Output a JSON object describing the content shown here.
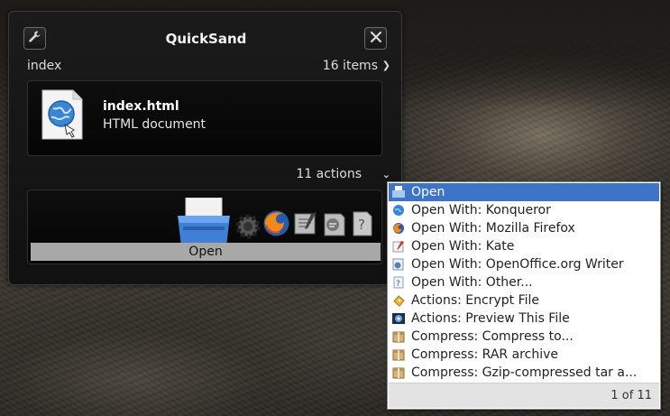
{
  "window": {
    "title": "QuickSand",
    "query": "index",
    "items_count": "16 items",
    "actions_count": "11 actions"
  },
  "icons": {
    "settings": "wrench-icon",
    "close": "close-icon",
    "items_chevron": "chevron-right-icon",
    "actions_chevron": "chevron-down-icon"
  },
  "selected_item": {
    "name": "index.html",
    "type": "HTML document",
    "icon": "html-file-icon"
  },
  "action_strip": {
    "current_label": "Open",
    "icons": [
      "open-printer-icon",
      "gear-icon",
      "firefox-icon",
      "kate-icon",
      "openoffice-writer-icon",
      "help-icon"
    ]
  },
  "action_list": {
    "items": [
      {
        "label": "Open",
        "icon": "printer-icon",
        "selected": true
      },
      {
        "label": "Open With: Konqueror",
        "icon": "konqueror-icon"
      },
      {
        "label": "Open With: Mozilla Firefox",
        "icon": "firefox-icon"
      },
      {
        "label": "Open With: Kate",
        "icon": "kate-icon"
      },
      {
        "label": "Open With: OpenOffice.org Writer",
        "icon": "writer-icon"
      },
      {
        "label": "Open With: Other...",
        "icon": "help-icon"
      },
      {
        "label": "Actions: Encrypt File",
        "icon": "lock-icon"
      },
      {
        "label": "Actions: Preview This File",
        "icon": "preview-icon"
      },
      {
        "label": "Compress: Compress to...",
        "icon": "archive-icon"
      },
      {
        "label": "Compress: RAR archive",
        "icon": "archive-icon"
      },
      {
        "label": "Compress: Gzip-compressed tar a...",
        "icon": "archive-icon"
      }
    ],
    "pager": "1 of 11"
  },
  "colors": {
    "selection": "#3d74c7",
    "panel_bg": "#151515"
  }
}
